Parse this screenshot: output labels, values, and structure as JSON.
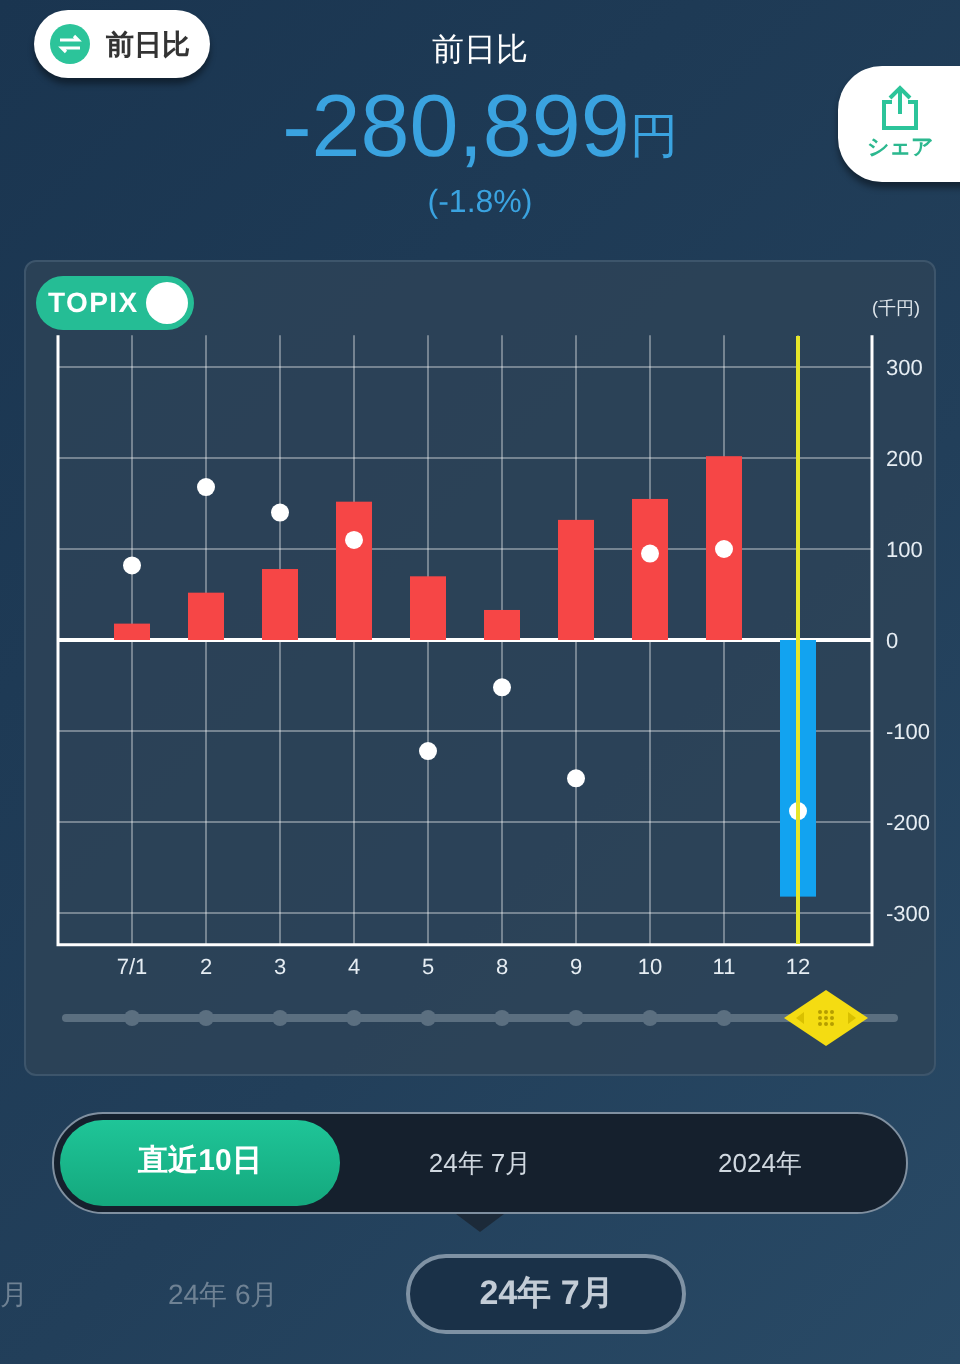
{
  "compare_button": {
    "label": "前日比"
  },
  "header": {
    "title": "前日比",
    "amount": "-280,899",
    "unit": "円",
    "percent": "(-1.8%)"
  },
  "share_button": {
    "label": "シェア"
  },
  "chart_card": {
    "topix_toggle": {
      "label": "TOPIX",
      "on": true
    },
    "unit_label": "(千円)",
    "chart_data": {
      "type": "bar",
      "categories": [
        "7/1",
        "2",
        "3",
        "4",
        "5",
        "8",
        "9",
        "10",
        "11",
        "12"
      ],
      "series": [
        {
          "color": "#f64646",
          "values": [
            18,
            52,
            78,
            152,
            70,
            33,
            132,
            155,
            202,
            null
          ]
        },
        {
          "color": "#12a3f0",
          "values": [
            null,
            null,
            null,
            null,
            null,
            null,
            null,
            null,
            null,
            -282
          ]
        },
        {
          "type": "scatter",
          "color": "#ffffff",
          "values": [
            82,
            168,
            140,
            110,
            -122,
            -52,
            -152,
            95,
            100,
            -188
          ]
        }
      ],
      "ylim": [
        -335,
        335
      ],
      "yticks": [
        -300,
        -200,
        -100,
        0,
        100,
        200,
        300
      ],
      "grid": true
    },
    "slider": {
      "level": 0.915
    }
  },
  "period_tabs": [
    {
      "label": "直近10日",
      "selected": true
    },
    {
      "label": "24年 7月",
      "selected": false
    },
    {
      "label": "2024年",
      "selected": false
    }
  ],
  "months": [
    {
      "label": "月",
      "selected": false
    },
    {
      "label": "24年 6月",
      "selected": false
    },
    {
      "label": "24年 7月",
      "selected": true
    }
  ]
}
